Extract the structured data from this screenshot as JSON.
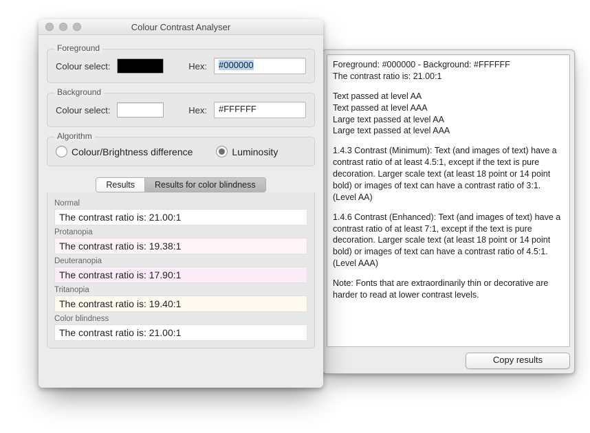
{
  "title": "Colour Contrast Analyser",
  "fg": {
    "group": "Foreground",
    "select_label": "Colour select:",
    "hex_label": "Hex:",
    "hex_value": "#000000"
  },
  "bg": {
    "group": "Background",
    "select_label": "Colour select:",
    "hex_label": "Hex:",
    "hex_value": "#FFFFFF"
  },
  "algo": {
    "group": "Algorithm",
    "opt1": "Colour/Brightness difference",
    "opt2": "Luminosity"
  },
  "tabs": {
    "a": "Results",
    "b": "Results for color blindness"
  },
  "results": {
    "items": [
      {
        "head": "Normal",
        "line": "The contrast ratio is: 21.00:1"
      },
      {
        "head": "Protanopia",
        "line": "The contrast ratio is: 19.38:1"
      },
      {
        "head": "Deuteranopia",
        "line": "The contrast ratio is: 17.90:1"
      },
      {
        "head": "Tritanopia",
        "line": "The contrast ratio is: 19.40:1"
      },
      {
        "head": "Color blindness",
        "line": "The contrast ratio is: 21.00:1"
      }
    ]
  },
  "report": {
    "header": "Foreground: #000000 - Background: #FFFFFF",
    "ratio": "The contrast ratio is: 21.00:1",
    "p1": "Text passed at level AA",
    "p2": "Text passed at level AAA",
    "p3": "Large text passed at level AA",
    "p4": "Large text passed at level AAA",
    "s143": "1.4.3 Contrast (Minimum):  Text (and images of text) have a contrast ratio of at least 4.5:1, except if the text is pure decoration.  Larger scale text (at least 18 point or 14 point bold) or images of text can have a contrast ratio of 3:1. (Level AA)",
    "s146": "1.4.6 Contrast (Enhanced): Text (and images of text) have a contrast ratio of at least 7:1, except if the text is pure decoration.  Larger scale text (at least 18 point or 14 point bold) or images of text can have a contrast ratio of 4.5:1. (Level AAA)",
    "note": "Note: Fonts that are extraordinarily thin or decorative are harder to read at lower contrast levels.",
    "copy_btn": "Copy results"
  }
}
